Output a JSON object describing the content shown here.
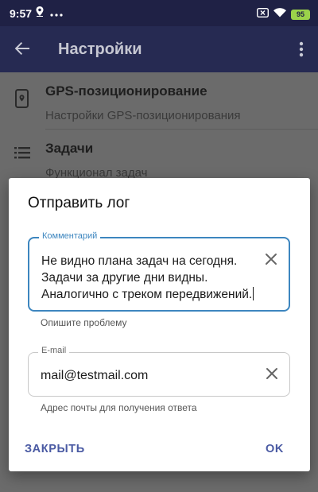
{
  "status_bar": {
    "time": "9:57",
    "left_icons": [
      "location-pin-icon",
      "more-dots-icon"
    ],
    "right_icons": [
      "no-sim-icon",
      "wifi-icon"
    ],
    "battery": "95"
  },
  "app_bar": {
    "title": "Настройки",
    "back_icon": "arrow-left-icon",
    "menu_icon": "more-vert-icon"
  },
  "settings": {
    "items": [
      {
        "title": "GPS-позиционирование",
        "subtitle": "Настройки GPS-позиционирования",
        "icon": "gps-phone-icon"
      },
      {
        "title": "Задачи",
        "subtitle": "Функционал задач",
        "icon": "list-icon"
      }
    ]
  },
  "dialog": {
    "title": "Отправить лог",
    "comment": {
      "label": "Комментарий",
      "value": "Не видно плана задач на сегодня.\nЗадачи за другие дни видны.\nАналогично с треком передвижений.",
      "helper": "Опишите проблему"
    },
    "email": {
      "label": "E-mail",
      "value": "mail@testmail.com",
      "helper": "Адрес почты для получения ответа"
    },
    "close_label": "ЗАКРЫТЬ",
    "ok_label": "OK"
  },
  "colors": {
    "accent": "#3d86bf",
    "button_text": "#4a5aa3",
    "status_bar": "#1f2145",
    "app_bar_dimmed": "#262a52",
    "battery": "#9bd24a"
  }
}
